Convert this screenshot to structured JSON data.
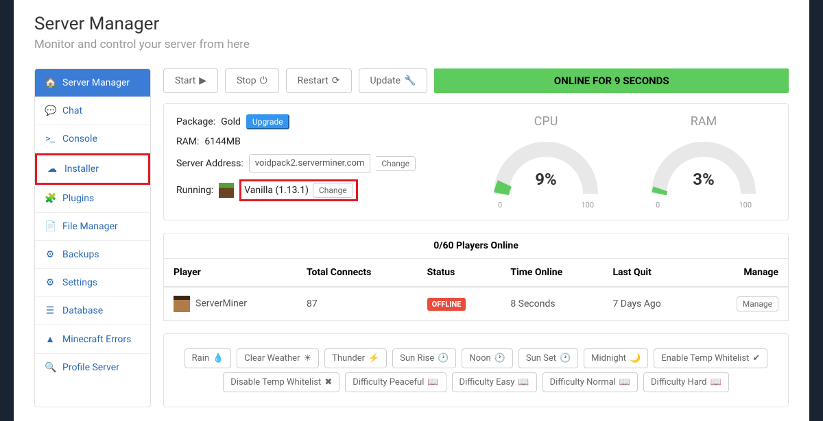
{
  "header": {
    "title": "Server Manager",
    "subtitle": "Monitor and control your server from here"
  },
  "sidebar": {
    "items": [
      {
        "label": "Server Manager",
        "icon": "home"
      },
      {
        "label": "Chat",
        "icon": "chat"
      },
      {
        "label": "Console",
        "icon": "terminal"
      },
      {
        "label": "Installer",
        "icon": "cloud"
      },
      {
        "label": "Plugins",
        "icon": "puzzle"
      },
      {
        "label": "File Manager",
        "icon": "file"
      },
      {
        "label": "Backups",
        "icon": "life-ring"
      },
      {
        "label": "Settings",
        "icon": "gear"
      },
      {
        "label": "Database",
        "icon": "database"
      },
      {
        "label": "Minecraft Errors",
        "icon": "warning"
      },
      {
        "label": "Profile Server",
        "icon": "search"
      }
    ]
  },
  "toolbar": {
    "start": "Start",
    "stop": "Stop",
    "restart": "Restart",
    "update": "Update",
    "status": "ONLINE FOR 9 SECONDS"
  },
  "info": {
    "package_label": "Package:",
    "package_value": "Gold",
    "upgrade": "Upgrade",
    "ram_label": "RAM:",
    "ram_value": "6144MB",
    "addr_label": "Server Address:",
    "addr_value": "voidpack2.serverminer.com",
    "change": "Change",
    "running_label": "Running:",
    "running_value": "Vanilla (1.13.1)"
  },
  "gauges": {
    "cpu_label": "CPU",
    "cpu_pct": "9%",
    "cpu_value": 9,
    "ram_label": "RAM",
    "ram_pct": "3%",
    "ram_value": 3,
    "min": "0",
    "max": "100"
  },
  "players": {
    "header": "0/60 Players Online",
    "cols": {
      "player": "Player",
      "connects": "Total Connects",
      "status": "Status",
      "time": "Time Online",
      "quit": "Last Quit",
      "manage": "Manage"
    },
    "rows": [
      {
        "name": "ServerMiner",
        "connects": "87",
        "status": "OFFLINE",
        "time": "8 Seconds",
        "quit": "7 Days Ago",
        "manage": "Manage"
      }
    ]
  },
  "actions": {
    "rain": "Rain",
    "clear": "Clear Weather",
    "thunder": "Thunder",
    "sunrise": "Sun Rise",
    "noon": "Noon",
    "sunset": "Sun Set",
    "midnight": "Midnight",
    "enable_wl": "Enable Temp Whitelist",
    "disable_wl": "Disable Temp Whitelist",
    "diff_peaceful": "Difficulty Peaceful",
    "diff_easy": "Difficulty Easy",
    "diff_normal": "Difficulty Normal",
    "diff_hard": "Difficulty Hard"
  }
}
